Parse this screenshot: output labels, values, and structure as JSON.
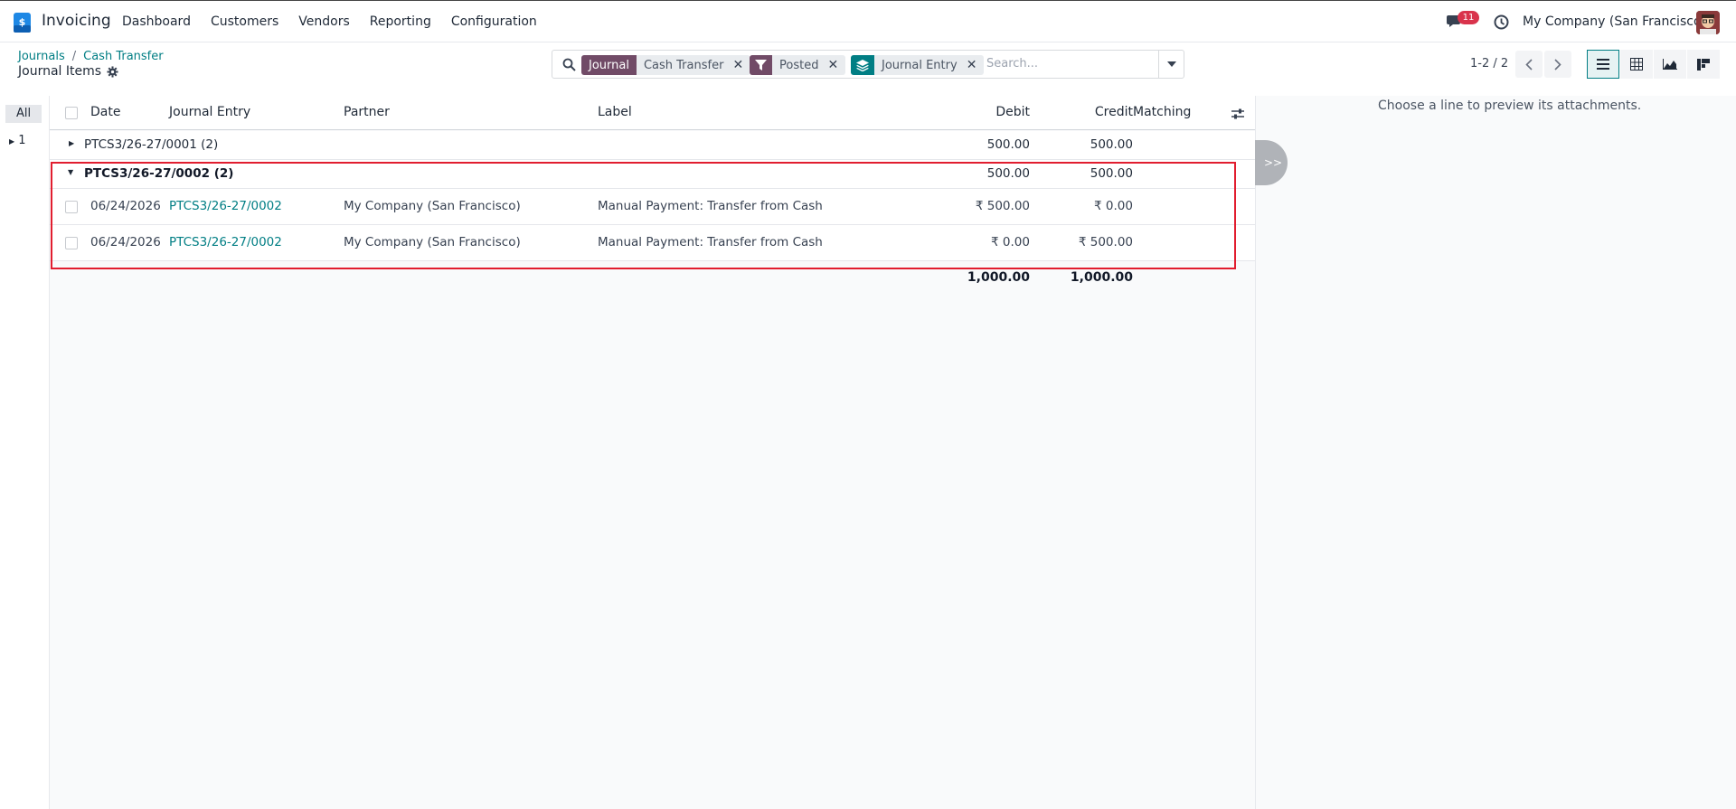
{
  "app": {
    "name": "Invoicing"
  },
  "menu": [
    "Dashboard",
    "Customers",
    "Vendors",
    "Reporting",
    "Configuration"
  ],
  "topbar": {
    "messages_count": "11",
    "company": "My Company (San Francisco)"
  },
  "breadcrumb": {
    "parent": "Journals",
    "separator": "/",
    "current": "Cash Transfer"
  },
  "page_title": "Journal Items",
  "search": {
    "facets": [
      {
        "tag": "Journal",
        "value": "Cash Transfer",
        "color": "#714B67"
      },
      {
        "icon": "filter-icon",
        "value": "Posted",
        "color": "#714B67"
      },
      {
        "icon": "layers-icon",
        "value": "Journal Entry",
        "color": "#017e84"
      }
    ],
    "placeholder": "Search..."
  },
  "pager": {
    "text": "1-2 / 2"
  },
  "side_panel": {
    "all_label": "All",
    "group_label": "1"
  },
  "columns": {
    "date": "Date",
    "journal_entry": "Journal Entry",
    "partner": "Partner",
    "label": "Label",
    "debit": "Debit",
    "credit": "Credit",
    "matching": "Matching"
  },
  "groups": [
    {
      "name": "PTCS3/26-27/0001 (2)",
      "debit": "500.00",
      "credit": "500.00",
      "expanded": false
    },
    {
      "name": "PTCS3/26-27/0002 (2)",
      "debit": "500.00",
      "credit": "500.00",
      "expanded": true
    }
  ],
  "rows": [
    {
      "date": "06/24/2026",
      "journal_entry": "PTCS3/26-27/0002",
      "partner": "My Company (San Francisco)",
      "label": "Manual Payment: Transfer from Cash",
      "debit": "₹ 500.00",
      "credit": "₹ 0.00"
    },
    {
      "date": "06/24/2026",
      "journal_entry": "PTCS3/26-27/0002",
      "partner": "My Company (San Francisco)",
      "label": "Manual Payment: Transfer from Cash",
      "debit": "₹ 0.00",
      "credit": "₹ 500.00"
    }
  ],
  "totals": {
    "debit": "1,000.00",
    "credit": "1,000.00"
  },
  "preview": {
    "collapse_label": ">>",
    "hint": "Choose a line to preview its attachments."
  },
  "colors": {
    "accent": "#017e84",
    "highlight": "#e11d2f",
    "brand": "#714B67"
  }
}
